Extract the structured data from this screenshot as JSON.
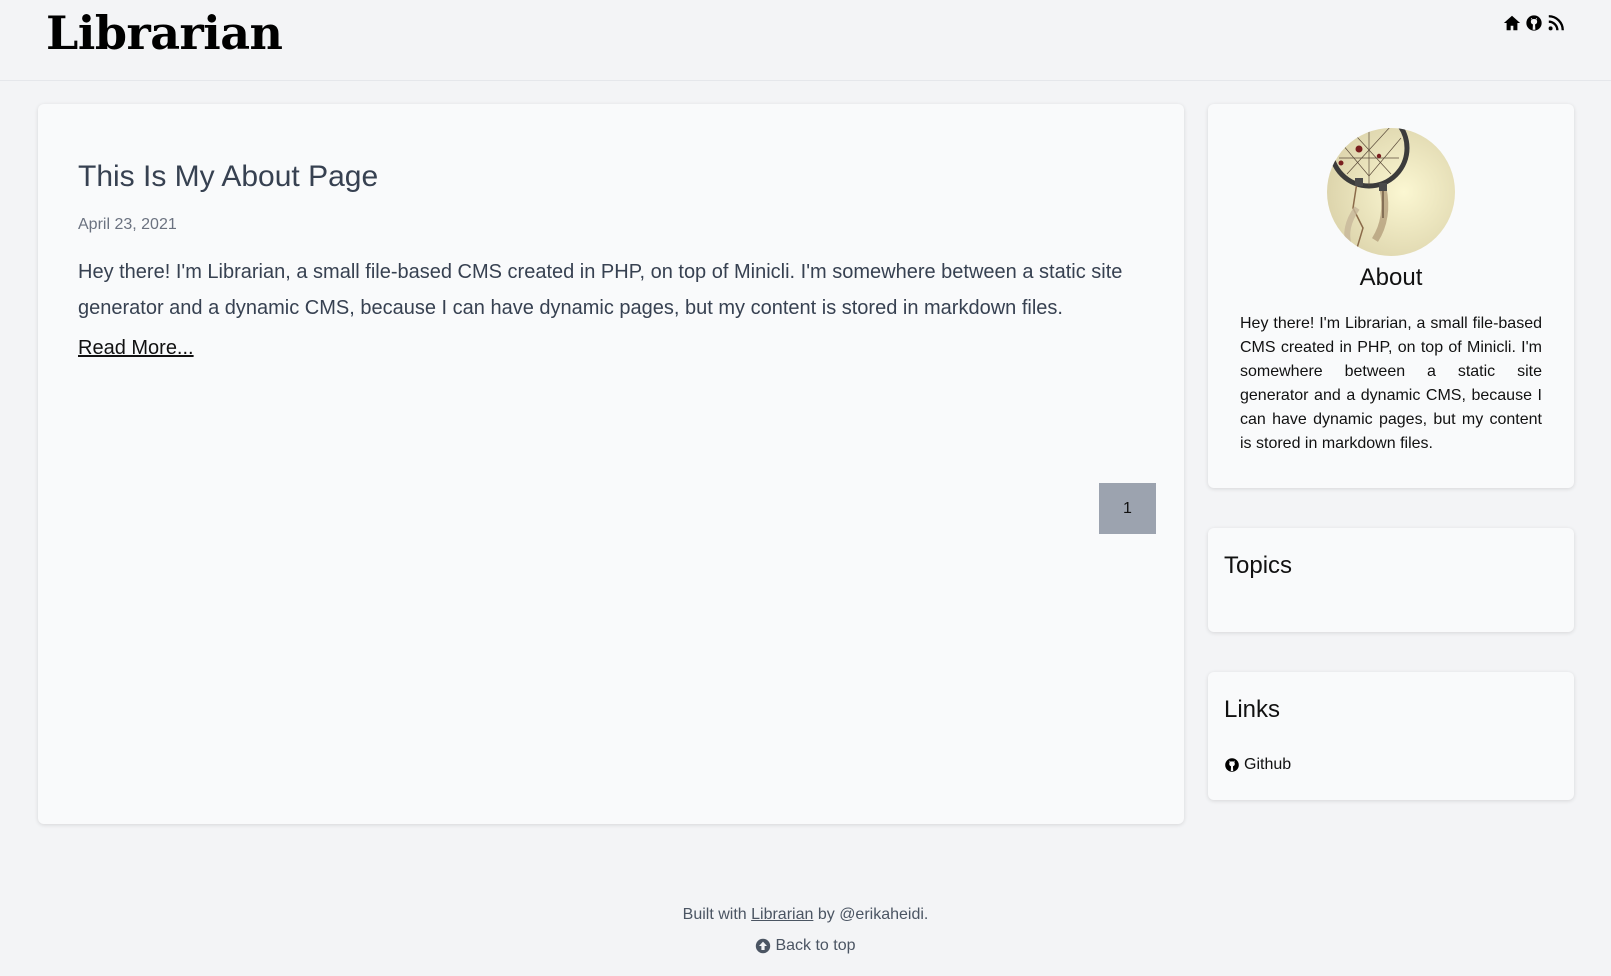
{
  "header": {
    "site_title": "Librarian",
    "icons": [
      "home-icon",
      "github-icon",
      "rss-icon"
    ]
  },
  "post": {
    "title": "This Is My About Page",
    "date": "April 23, 2021",
    "excerpt": "Hey there! I'm Librarian, a small file-based CMS created in PHP, on top of Minicli. I'm somewhere between a static site generator and a dynamic CMS, because I can have dynamic pages, but my content is stored in markdown files.",
    "read_more": "Read More..."
  },
  "pagination": {
    "current_page": "1"
  },
  "sidebar": {
    "about": {
      "title": "About",
      "text": "Hey there! I'm Librarian, a small file-based CMS created in PHP, on top of Minicli. I'm somewhere between a static site generator and a dynamic CMS, because I can have dynamic pages, but my content is stored in markdown files."
    },
    "topics": {
      "title": "Topics"
    },
    "links": {
      "title": "Links",
      "items": [
        {
          "label": "Github",
          "icon": "github-icon"
        }
      ]
    }
  },
  "footer": {
    "built_with_prefix": "Built with",
    "built_with_link": "Librarian",
    "built_with_suffix": "by @erikaheidi.",
    "back_to_top": "Back to top"
  },
  "colors": {
    "page_bg": "#f3f4f6",
    "card_bg": "#f9fafb",
    "pagination_bg": "#9ca3af",
    "muted_text": "#6b7280"
  }
}
